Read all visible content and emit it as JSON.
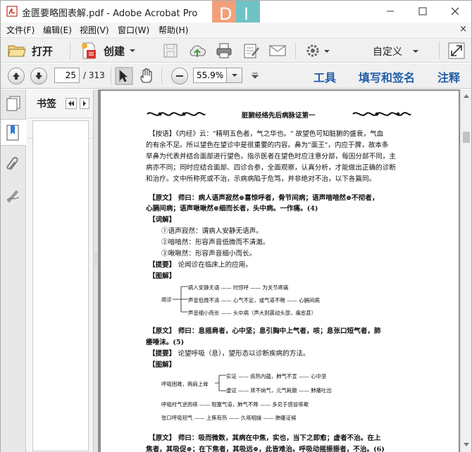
{
  "window": {
    "title": "金匮要略图表解.pdf - Adobe Acrobat Pro",
    "logo_text": "DI"
  },
  "menu": {
    "items": [
      "文件(F)",
      "编辑(E)",
      "视图(V)",
      "窗口(W)",
      "帮助(H)"
    ],
    "close_symbol": "×"
  },
  "toolbar": {
    "open_label": "打开",
    "create_label": "创建",
    "customize_label": "自定义"
  },
  "nav": {
    "current_page": "25",
    "total_pages": "/ 313",
    "zoom": "55.9%",
    "tools_label": "工具",
    "fill_sign_label": "填写和签名",
    "comment_label": "注释"
  },
  "bookmarks": {
    "title": "书签"
  },
  "document": {
    "header": "脏腑经络先后病脉证第一",
    "note_lines": [
      "【按语】《内经》云：\"精明五色者，气之华也。\" 故望色可知脏腑的盛衰，气血",
      "的有余不足。所以望色在望诊中是很重要的内容。鼻为\"面王\"，内应于脾，故本条",
      "举鼻为代表并结合面部进行望色，指示医者在望色时应注意分部，每因分部不同，主",
      "病亦不同；同时应结合面部、四诊合参，全面观察，认真分析，才能做出正确的诊断",
      "和治疗。文中所称死或不治，示病病陷于危笃，并非绝对不治，以下各篇同。"
    ],
    "original_1_lines": [
      "【原文】 师曰：病人语声寂然⊕喜惊呼者，骨节间病；语声喑喑然⊕不彻者，",
      "心膈间病；语声啾啾然⊕细而长者，头中病。一作痛。(4)"
    ],
    "glossary_heading": "【词解】",
    "glossary": [
      "①语声寂然：谓病人安静无语声。",
      "②喑喑然：形容声音低微而不清澈。",
      "③啾啾然：形容声音细小而长。"
    ],
    "summary_heading": "【提要】",
    "summary_1": "论闻诊在临床上的应用。",
    "diagram_heading": "【图解】",
    "diagram_1": {
      "root": "闻诊",
      "rows": [
        "病人安静无语 —— 时惊呼 —— 为关节疼痛",
        "声音低微不清 —— 心气不足，或气道不畅 —— 心膈间病",
        "声音细小而长 —— 头中病（声大则震动头部，痛愈甚）"
      ]
    },
    "original_2": "【原文】 师曰：息摇肩者，心中坚；息引胸中上气者，咳；息张口短气者，肺",
    "original_2b": "痿唾沫。(5)",
    "summary_2": "论望呼吸（息），望形态以诊断疾病的方法。",
    "diagram_heading_2": "【图解】",
    "diagram_2": {
      "root": "呼吸困难，两肩上耸",
      "rows": [
        "实证 —— 痰热内蕴，肺气不宣 —— 心中坚",
        "虚证 —— 肾不纳气，元气耗散 —— 肺痿吐出"
      ],
      "line_3": "呼吸时气逆而咳 —— 阻塞气道，肺气不降 —— 多见于感冒咳嗽",
      "line_4": "张口呼吸短气 —— 上焦有热 —— 久咳咽燥 —— 肺痿证候"
    },
    "original_3_lines": [
      "【原文】 师曰：吸而微数，其病在中焦，实也，当下之即愈；虚者不治。在上",
      "焦者，其吸促⊕；在下焦者，其吸远⊕，此皆难治。呼吸动摇振振者，不治。(6)"
    ]
  }
}
